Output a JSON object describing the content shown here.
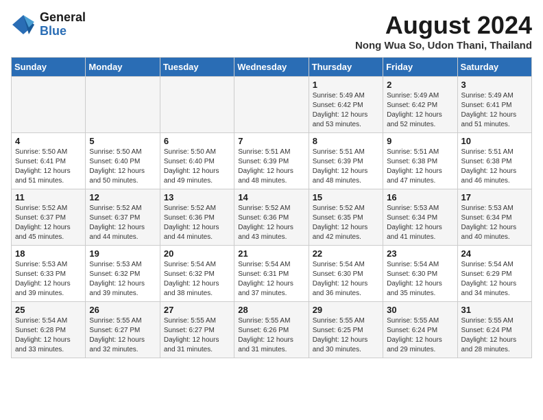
{
  "header": {
    "logo_line1": "General",
    "logo_line2": "Blue",
    "title": "August 2024",
    "subtitle": "Nong Wua So, Udon Thani, Thailand"
  },
  "weekdays": [
    "Sunday",
    "Monday",
    "Tuesday",
    "Wednesday",
    "Thursday",
    "Friday",
    "Saturday"
  ],
  "weeks": [
    [
      {
        "day": "",
        "info": ""
      },
      {
        "day": "",
        "info": ""
      },
      {
        "day": "",
        "info": ""
      },
      {
        "day": "",
        "info": ""
      },
      {
        "day": "1",
        "info": "Sunrise: 5:49 AM\nSunset: 6:42 PM\nDaylight: 12 hours\nand 53 minutes."
      },
      {
        "day": "2",
        "info": "Sunrise: 5:49 AM\nSunset: 6:42 PM\nDaylight: 12 hours\nand 52 minutes."
      },
      {
        "day": "3",
        "info": "Sunrise: 5:49 AM\nSunset: 6:41 PM\nDaylight: 12 hours\nand 51 minutes."
      }
    ],
    [
      {
        "day": "4",
        "info": "Sunrise: 5:50 AM\nSunset: 6:41 PM\nDaylight: 12 hours\nand 51 minutes."
      },
      {
        "day": "5",
        "info": "Sunrise: 5:50 AM\nSunset: 6:40 PM\nDaylight: 12 hours\nand 50 minutes."
      },
      {
        "day": "6",
        "info": "Sunrise: 5:50 AM\nSunset: 6:40 PM\nDaylight: 12 hours\nand 49 minutes."
      },
      {
        "day": "7",
        "info": "Sunrise: 5:51 AM\nSunset: 6:39 PM\nDaylight: 12 hours\nand 48 minutes."
      },
      {
        "day": "8",
        "info": "Sunrise: 5:51 AM\nSunset: 6:39 PM\nDaylight: 12 hours\nand 48 minutes."
      },
      {
        "day": "9",
        "info": "Sunrise: 5:51 AM\nSunset: 6:38 PM\nDaylight: 12 hours\nand 47 minutes."
      },
      {
        "day": "10",
        "info": "Sunrise: 5:51 AM\nSunset: 6:38 PM\nDaylight: 12 hours\nand 46 minutes."
      }
    ],
    [
      {
        "day": "11",
        "info": "Sunrise: 5:52 AM\nSunset: 6:37 PM\nDaylight: 12 hours\nand 45 minutes."
      },
      {
        "day": "12",
        "info": "Sunrise: 5:52 AM\nSunset: 6:37 PM\nDaylight: 12 hours\nand 44 minutes."
      },
      {
        "day": "13",
        "info": "Sunrise: 5:52 AM\nSunset: 6:36 PM\nDaylight: 12 hours\nand 44 minutes."
      },
      {
        "day": "14",
        "info": "Sunrise: 5:52 AM\nSunset: 6:36 PM\nDaylight: 12 hours\nand 43 minutes."
      },
      {
        "day": "15",
        "info": "Sunrise: 5:52 AM\nSunset: 6:35 PM\nDaylight: 12 hours\nand 42 minutes."
      },
      {
        "day": "16",
        "info": "Sunrise: 5:53 AM\nSunset: 6:34 PM\nDaylight: 12 hours\nand 41 minutes."
      },
      {
        "day": "17",
        "info": "Sunrise: 5:53 AM\nSunset: 6:34 PM\nDaylight: 12 hours\nand 40 minutes."
      }
    ],
    [
      {
        "day": "18",
        "info": "Sunrise: 5:53 AM\nSunset: 6:33 PM\nDaylight: 12 hours\nand 39 minutes."
      },
      {
        "day": "19",
        "info": "Sunrise: 5:53 AM\nSunset: 6:32 PM\nDaylight: 12 hours\nand 39 minutes."
      },
      {
        "day": "20",
        "info": "Sunrise: 5:54 AM\nSunset: 6:32 PM\nDaylight: 12 hours\nand 38 minutes."
      },
      {
        "day": "21",
        "info": "Sunrise: 5:54 AM\nSunset: 6:31 PM\nDaylight: 12 hours\nand 37 minutes."
      },
      {
        "day": "22",
        "info": "Sunrise: 5:54 AM\nSunset: 6:30 PM\nDaylight: 12 hours\nand 36 minutes."
      },
      {
        "day": "23",
        "info": "Sunrise: 5:54 AM\nSunset: 6:30 PM\nDaylight: 12 hours\nand 35 minutes."
      },
      {
        "day": "24",
        "info": "Sunrise: 5:54 AM\nSunset: 6:29 PM\nDaylight: 12 hours\nand 34 minutes."
      }
    ],
    [
      {
        "day": "25",
        "info": "Sunrise: 5:54 AM\nSunset: 6:28 PM\nDaylight: 12 hours\nand 33 minutes."
      },
      {
        "day": "26",
        "info": "Sunrise: 5:55 AM\nSunset: 6:27 PM\nDaylight: 12 hours\nand 32 minutes."
      },
      {
        "day": "27",
        "info": "Sunrise: 5:55 AM\nSunset: 6:27 PM\nDaylight: 12 hours\nand 31 minutes."
      },
      {
        "day": "28",
        "info": "Sunrise: 5:55 AM\nSunset: 6:26 PM\nDaylight: 12 hours\nand 31 minutes."
      },
      {
        "day": "29",
        "info": "Sunrise: 5:55 AM\nSunset: 6:25 PM\nDaylight: 12 hours\nand 30 minutes."
      },
      {
        "day": "30",
        "info": "Sunrise: 5:55 AM\nSunset: 6:24 PM\nDaylight: 12 hours\nand 29 minutes."
      },
      {
        "day": "31",
        "info": "Sunrise: 5:55 AM\nSunset: 6:24 PM\nDaylight: 12 hours\nand 28 minutes."
      }
    ]
  ]
}
